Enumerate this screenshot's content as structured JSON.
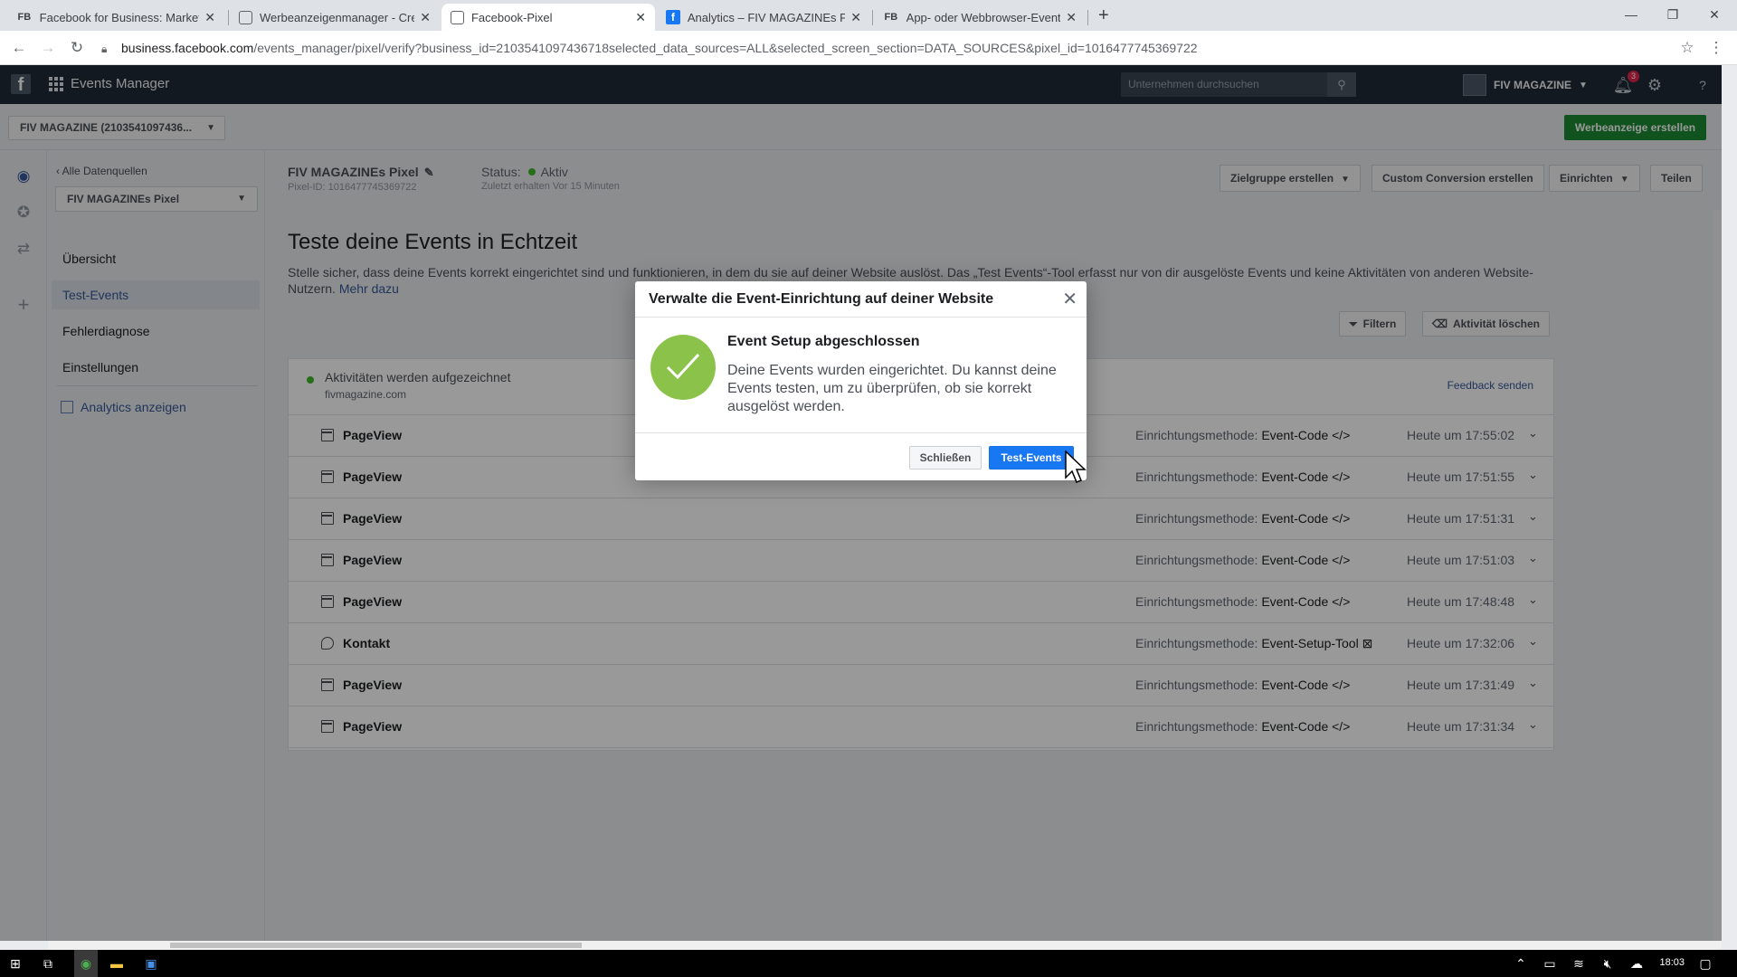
{
  "browser": {
    "tabs": [
      {
        "favicon": "FB",
        "title": "Facebook for Business: Marketing"
      },
      {
        "favicon": "doc",
        "title": "Werbeanzeigenmanager - Creati"
      },
      {
        "favicon": "doc",
        "title": "Facebook-Pixel"
      },
      {
        "favicon": "f",
        "title": "Analytics – FIV MAGAZINEs Pixel"
      },
      {
        "favicon": "FB",
        "title": "App- oder Webbrowser-Events n"
      }
    ],
    "active_tab": 2,
    "new_tab": "+",
    "url_host": "business.facebook.com",
    "url_path": "/events_manager/pixel/verify?business_id=2103541097436718selected_data_sources=ALL&selected_screen_section=DATA_SOURCES&pixel_id=1016477745369722"
  },
  "topnav": {
    "app_name": "Events Manager",
    "search_placeholder": "Unternehmen durchsuchen",
    "account_name": "FIV MAGAZINE",
    "notification_count": "3"
  },
  "subheader": {
    "account_selector": "FIV MAGAZINE (2103541097436...",
    "create_ad": "Werbeanzeige erstellen"
  },
  "leftnav": {
    "back_link": "Alle Datenquellen",
    "pixel_selector": "FIV MAGAZINEs Pixel",
    "items": [
      {
        "label": "Übersicht"
      },
      {
        "label": "Test-Events"
      },
      {
        "label": "Fehlerdiagnose"
      },
      {
        "label": "Einstellungen"
      }
    ],
    "selected_index": 1,
    "analytics_link": "Analytics anzeigen"
  },
  "pixel": {
    "name": "FIV MAGAZINEs Pixel",
    "id_label": "Pixel-ID: 1016477745369722",
    "status_label": "Status:",
    "status_value": "Aktiv",
    "last_received": "Zuletzt erhalten Vor 15 Minuten"
  },
  "header_buttons": {
    "audience": "Zielgruppe erstellen",
    "custom_conversion": "Custom Conversion erstellen",
    "setup": "Einrichten",
    "share": "Teilen"
  },
  "page": {
    "title": "Teste deine Events in Echtzeit",
    "description": "Stelle sicher, dass deine Events korrekt eingerichtet sind und funktionieren, in dem du sie auf deiner Website auslöst. Das „Test Events“-Tool erfasst nur von dir ausgelöste Events und keine Aktivitäten von anderen Website-Nutzern.",
    "more_link": "Mehr dazu",
    "filter_button": "Filtern",
    "clear_button": "Aktivität löschen"
  },
  "recording": {
    "title": "Aktivitäten werden aufgezeichnet",
    "domain": "fivmagazine.com",
    "feedback": "Feedback senden"
  },
  "events": [
    {
      "name": "PageView",
      "icon": "page-icon",
      "method_label": "Einrichtungsmethode:",
      "method": "Event-Code </>",
      "time": "Heute um 17:55:02"
    },
    {
      "name": "PageView",
      "icon": "page-icon",
      "method_label": "Einrichtungsmethode:",
      "method": "Event-Code </>",
      "time": "Heute um 17:51:55"
    },
    {
      "name": "PageView",
      "icon": "page-icon",
      "method_label": "Einrichtungsmethode:",
      "method": "Event-Code </>",
      "time": "Heute um 17:51:31"
    },
    {
      "name": "PageView",
      "icon": "page-icon",
      "method_label": "Einrichtungsmethode:",
      "method": "Event-Code </>",
      "time": "Heute um 17:51:03"
    },
    {
      "name": "PageView",
      "icon": "page-icon",
      "method_label": "Einrichtungsmethode:",
      "method": "Event-Code </>",
      "time": "Heute um 17:48:48"
    },
    {
      "name": "Kontakt",
      "icon": "speech-bubble-icon",
      "method_label": "Einrichtungsmethode:",
      "method": "Event-Setup-Tool ⊠",
      "time": "Heute um 17:32:06"
    },
    {
      "name": "PageView",
      "icon": "page-icon",
      "method_label": "Einrichtungsmethode:",
      "method": "Event-Code </>",
      "time": "Heute um 17:31:49"
    },
    {
      "name": "PageView",
      "icon": "page-icon",
      "method_label": "Einrichtungsmethode:",
      "method": "Event-Code </>",
      "time": "Heute um 17:31:34"
    }
  ],
  "modal": {
    "title": "Verwalte die Event-Einrichtung auf deiner Website",
    "heading": "Event Setup abgeschlossen",
    "body": "Deine Events wurden eingerichtet. Du kannst deine Events testen, um zu überprüfen, ob sie korrekt ausgelöst werden.",
    "close_button": "Schließen",
    "test_button": "Test-Events",
    "check_color": "#8bc34a"
  },
  "taskbar": {
    "time": "18:03"
  },
  "colors": {
    "fb_nav": "#1f2a36",
    "primary_blue": "#1877f2",
    "green_cta": "#1d8b33",
    "status_green": "#42b72a",
    "link_blue": "#365899"
  }
}
